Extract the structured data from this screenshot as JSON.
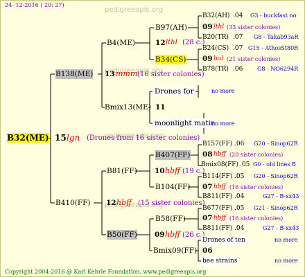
{
  "header": {
    "date": "24- 12-2016 ( 20: 27)"
  },
  "footer": {
    "copyright": "Copyright 2004-2016 @ Karl Kehrle Foundation.   www.pedigreeapis.org"
  },
  "watermark": {
    "text": "pedigreeapis.org"
  },
  "colors": {
    "background": "#ffffe0",
    "highlight_grey": "#c0c0c0",
    "highlight_yellow": "#ffff00",
    "accent_red": "#e00000",
    "accent_purple": "#8800aa",
    "accent_blue": "#0000cc"
  },
  "root": {
    "id": "B32(ME)",
    "gen": "15",
    "mating": "lgn",
    "drones": "(Drones from 16 sister colonies)"
  },
  "gen1": [
    {
      "id": "B138(ME)",
      "gen": "13",
      "mating": "mmm",
      "sisters": "(16 sister colonies)"
    },
    {
      "id": "B410(FF)",
      "gen": "12",
      "mating": "hbff",
      "sisters": "(15 sister colonies)"
    }
  ],
  "gen2": [
    {
      "id": "B4(ME)"
    },
    {
      "id": "Bmix13(ME)",
      "gen": "11"
    },
    {
      "id": "B81(FF)",
      "gen": "10",
      "mating": "hbff",
      "sisters": "(19 c.)"
    },
    {
      "id": "B50(FF)",
      "gen": "09",
      "mating": "hbff",
      "sisters": "(26 c.)"
    }
  ],
  "gen3": [
    {
      "id": "B97(AH)",
      "gen": "12",
      "mating": "lthl",
      "sisters": "(28 c.)"
    },
    {
      "id": "B34(CS)",
      "gen": "09",
      "mating": "bal",
      "sisters": "(21 sister colonies)"
    },
    {
      "id": "Drones for",
      "note": "no more"
    },
    {
      "id": "moonlight matin",
      "note": "no more"
    },
    {
      "id": "B407(FF)",
      "gen": "08",
      "mating": "hbff",
      "sisters": "(20 sister colonies)"
    },
    {
      "id": "B104(FF)",
      "gen": "07",
      "mating": "hbff",
      "sisters": "(16 sister colonies)"
    },
    {
      "id": "B58(FF)",
      "gen": "07",
      "mating": "hbff",
      "sisters": "(16 sister colonies)"
    },
    {
      "id": "Bmix09(FF)",
      "gen": "06"
    }
  ],
  "gen4": [
    {
      "id": "B32(AH)",
      "num": ".04",
      "code": "G3 - buckfast no"
    },
    {
      "id": "B20(TR)",
      "num": ".07",
      "code": "G8 - Takab93aR"
    },
    {
      "id": "B24(CS)",
      "num": ".07",
      "code": "G15 - AthosSt80R"
    },
    {
      "id": "B78(TR)",
      "num": ".06",
      "code": "G8 - NO6294R"
    },
    {
      "id": "B157(FF)",
      "num": ".06",
      "code": "G20 - Sinop62R"
    },
    {
      "id": "Bmix08(FF)",
      "num": ".05",
      "code": "G0 - old lines B"
    },
    {
      "id": "B114(FF)",
      "num": ".05",
      "code": "G20 - Sinop62R"
    },
    {
      "id": "B811(FF)",
      "num": ".04",
      "code": "G27 - B-xx43"
    },
    {
      "id": "B677(FF)",
      "num": ".05",
      "code": "G21 - Sinop62R"
    },
    {
      "id": "B811(FF)",
      "num": ".04",
      "code": "G27 - B-xx43"
    },
    {
      "id": "Drones of ten",
      "code": "no more"
    },
    {
      "id": "bee strains",
      "code": "no more"
    }
  ],
  "gen4_sibs": [
    {
      "gen": "09",
      "mating": "lthl",
      "sisters": "(33 sister colonies)"
    }
  ]
}
